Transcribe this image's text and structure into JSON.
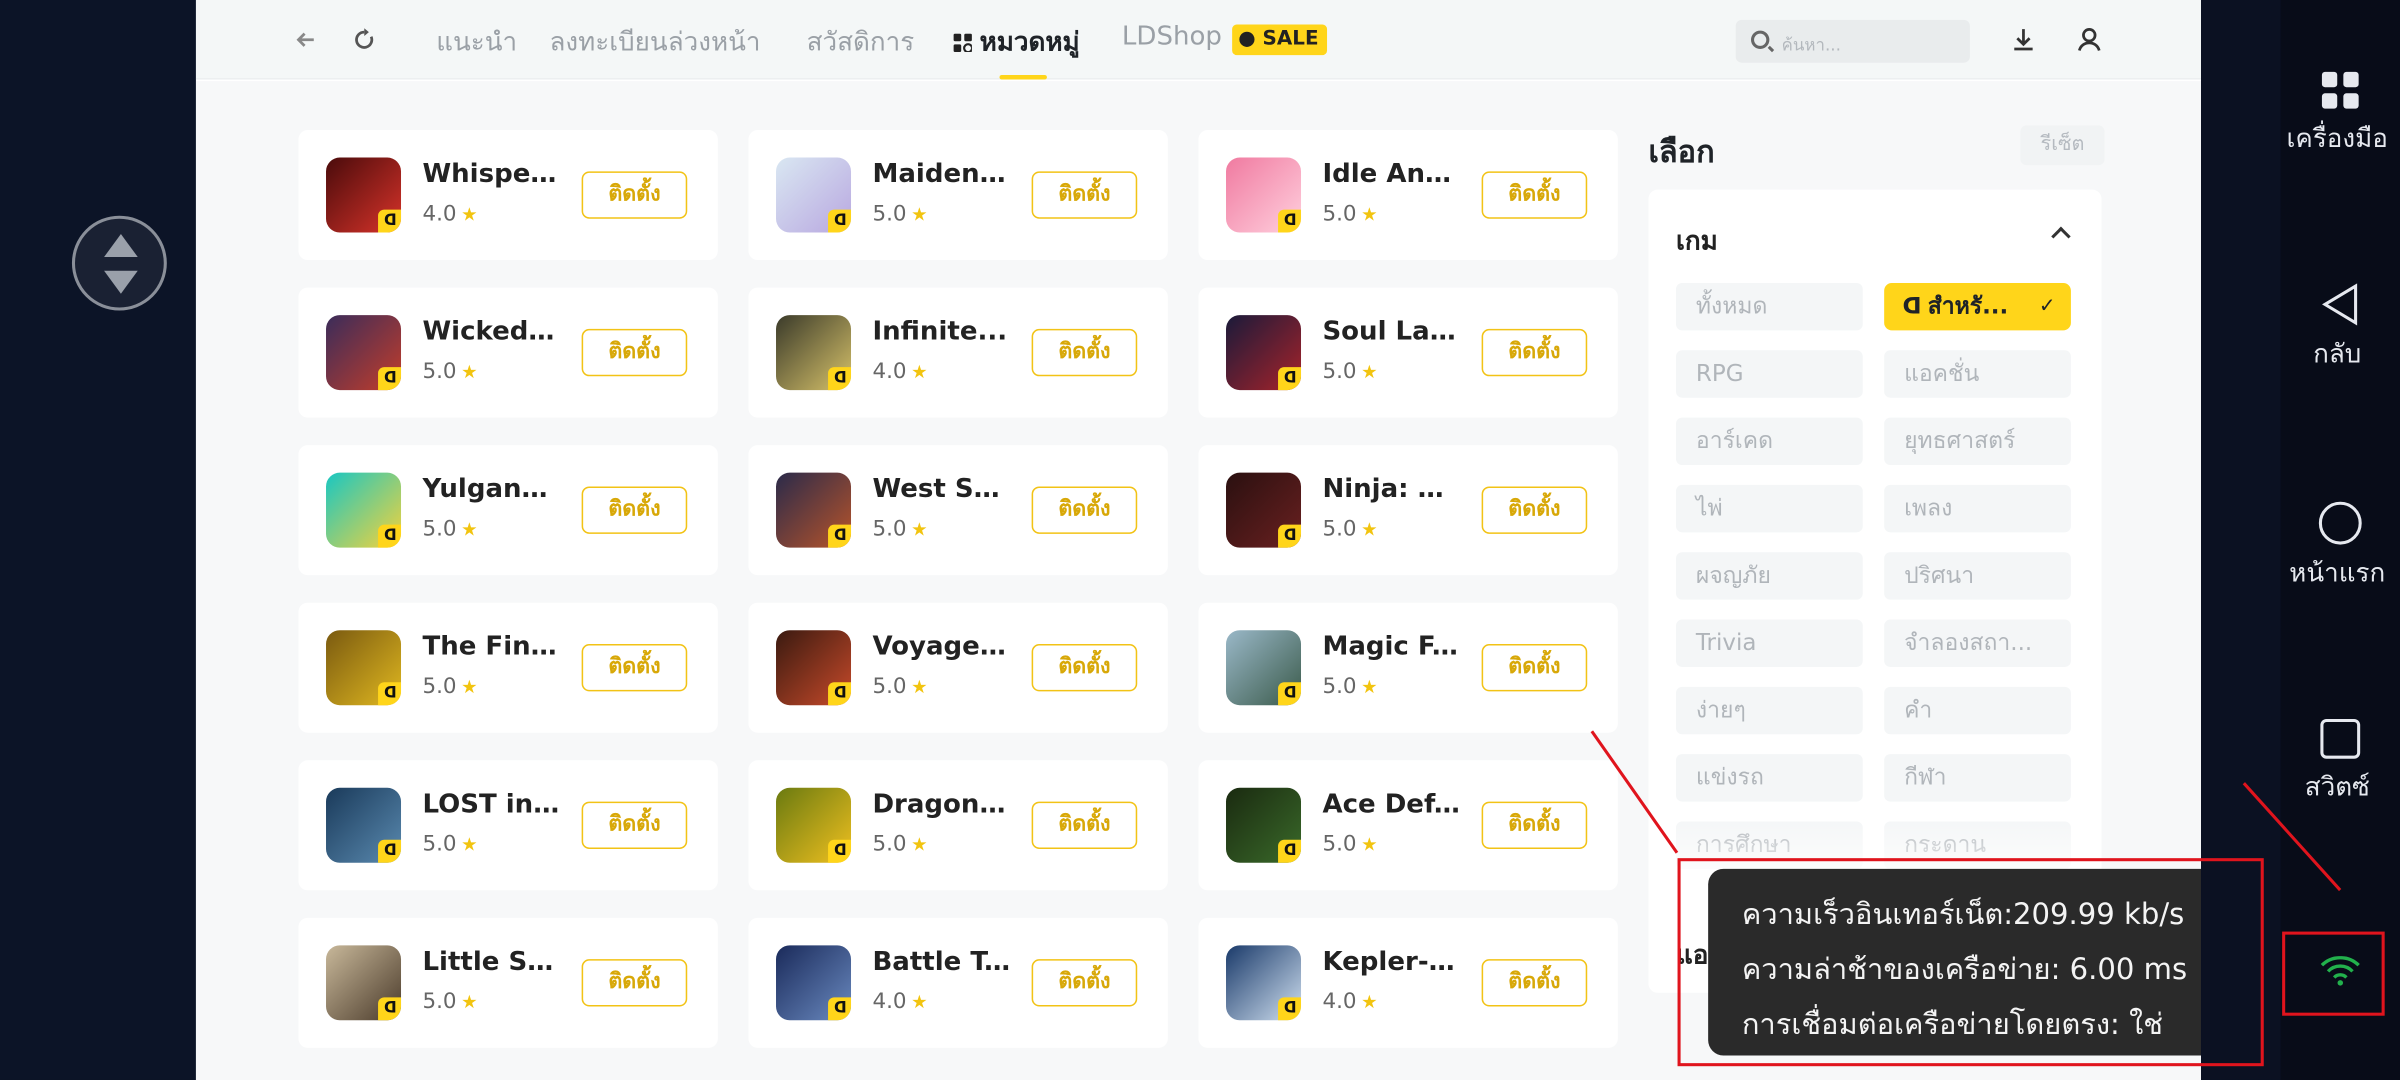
{
  "nav": {
    "tabs": [
      {
        "label": "แนะนำ"
      },
      {
        "label": "ลงทะเบียนล่วงหน้า"
      },
      {
        "label": "สวัสดิการ"
      },
      {
        "label": "หมวดหมู่"
      },
      {
        "label": "LDShop"
      }
    ],
    "sale_badge": "SALE",
    "search_placeholder": "ค้นหา..."
  },
  "games": [
    {
      "name": "Whisper...",
      "rating": "4.0",
      "install_label": "ติดตั้ง"
    },
    {
      "name": "Maidens...",
      "rating": "5.0",
      "install_label": "ติดตั้ง"
    },
    {
      "name": "Idle Ang...",
      "rating": "5.0",
      "install_label": "ติดตั้ง"
    },
    {
      "name": "Wicked ...",
      "rating": "5.0",
      "install_label": "ติดตั้ง"
    },
    {
      "name": "Infinite...",
      "rating": "4.0",
      "install_label": "ติดตั้ง"
    },
    {
      "name": "Soul Lan...",
      "rating": "5.0",
      "install_label": "ติดตั้ง"
    },
    {
      "name": "Yulgang...",
      "rating": "5.0",
      "install_label": "ติดตั้ง"
    },
    {
      "name": "West Su...",
      "rating": "5.0",
      "install_label": "ติดตั้ง"
    },
    {
      "name": "Ninja: S...",
      "rating": "5.0",
      "install_label": "ติดตั้ง"
    },
    {
      "name": "The Fina...",
      "rating": "5.0",
      "install_label": "ติดตั้ง"
    },
    {
      "name": "Voyage ...",
      "rating": "5.0",
      "install_label": "ติดตั้ง"
    },
    {
      "name": "Magic F...",
      "rating": "5.0",
      "install_label": "ติดตั้ง"
    },
    {
      "name": "LOST in ...",
      "rating": "5.0",
      "install_label": "ติดตั้ง"
    },
    {
      "name": "Dragon ...",
      "rating": "5.0",
      "install_label": "ติดตั้ง"
    },
    {
      "name": "Ace Def...",
      "rating": "5.0",
      "install_label": "ติดตั้ง"
    },
    {
      "name": "Little Sh...",
      "rating": "5.0",
      "install_label": "ติดตั้ง"
    },
    {
      "name": "Battle T...",
      "rating": "4.0",
      "install_label": "ติดตั้ง"
    },
    {
      "name": "Kepler-2...",
      "rating": "4.0",
      "install_label": "ติดตั้ง"
    }
  ],
  "filter": {
    "title": "เลือก",
    "reset_label": "รีเซ็ต",
    "section_game": "เกม",
    "section_app": "แอป",
    "chips": [
      "ทั้งหมด",
      "สำหรั...",
      "RPG",
      "แอคชั่น",
      "อาร์เคด",
      "ยุทธศาสตร์",
      "ไพ่",
      "เพลง",
      "ผจญภัย",
      "ปริศนา",
      "Trivia",
      "จำลองสถา...",
      "ง่ายๆ",
      "คำ",
      "แข่งรถ",
      "กีฬา",
      "การศึกษา",
      "กระดาน"
    ]
  },
  "network_tooltip": {
    "speed": "ความเร็วอินเทอร์เน็ต:209.99 kb/s",
    "latency": "ความล่าช้าของเครือข่าย: 6.00 ms",
    "direct": "การเชื่อมต่อเครือข่ายโดยตรง: ใช่"
  },
  "sidebar": {
    "tools": "เครื่องมือ",
    "back": "กลับ",
    "home": "หน้าแรก",
    "switch": "สวิตซ์"
  }
}
